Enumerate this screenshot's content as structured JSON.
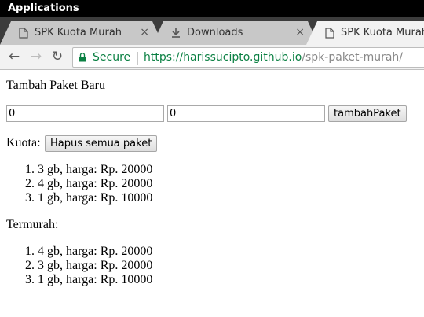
{
  "os": {
    "title": "Applications"
  },
  "tabs": [
    {
      "label": "SPK Kuota Murah",
      "close": "×",
      "icon": "page-icon",
      "active": false
    },
    {
      "label": "Downloads",
      "close": "×",
      "icon": "download-icon",
      "active": false
    },
    {
      "label": "SPK Kuota Murah",
      "close": "",
      "icon": "page-icon",
      "active": true
    }
  ],
  "toolbar": {
    "back": "←",
    "forward": "→",
    "reload": "↻",
    "secure_label": "Secure",
    "url_scheme": "https://",
    "url_host": "harissucipto.github.io",
    "url_path": "/spk-paket-murah/"
  },
  "page": {
    "heading": "Tambah Paket Baru",
    "input_a_value": "0",
    "input_b_value": "0",
    "add_button": "tambahPaket",
    "kuota_label": "Kuota:",
    "clear_button": "Hapus semua paket",
    "kuota_items": [
      "3 gb, harga: Rp. 20000",
      "4 gb, harga: Rp. 20000",
      "1 gb, harga: Rp. 10000"
    ],
    "termurah_label": "Termurah:",
    "termurah_items": [
      "4 gb, harga: Rp. 20000",
      "3 gb, harga: Rp. 20000",
      "1 gb, harga: Rp. 10000"
    ]
  },
  "colors": {
    "secure_green": "#0b8043",
    "os_bar": "#000000",
    "tabstrip": "#3c3c3c"
  }
}
